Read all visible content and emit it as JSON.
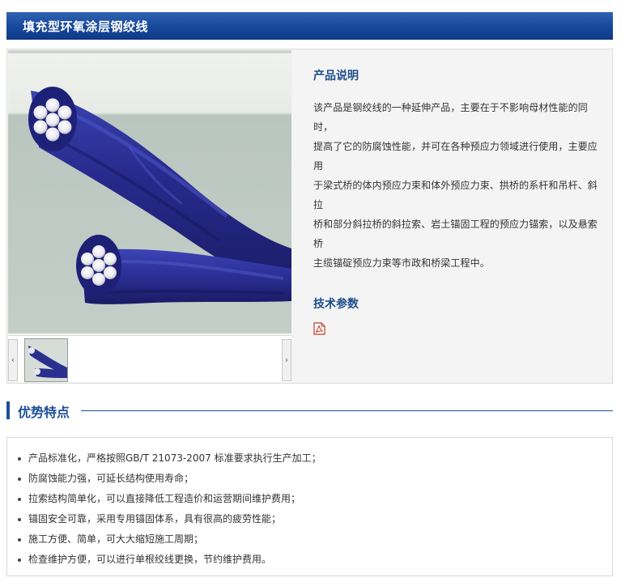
{
  "header": {
    "title": "填充型环氧涂层钢绞线"
  },
  "product": {
    "image_alt": "epoxy coated steel strand photo",
    "gallery": {
      "prev_arrow": "‹",
      "next_arrow": "›"
    },
    "description_title": "产品说明",
    "description_lines": [
      "该产品是钢绞线的一种延伸产品，主要在于不影响母材性能的同时，",
      "提高了它的防腐蚀性能，并可在各种预应力领域进行使用，主要应用",
      "于梁式桥的体内预应力束和体外预应力束、拱桥的系杆和吊杆、斜拉",
      "桥和部分斜拉桥的斜拉索、岩土锚固工程的预应力锚索，以及悬索桥",
      "主缆锚碇预应力束等市政和桥梁工程中。"
    ],
    "tech_title": "技术参数",
    "tech_icon": "pdf-icon"
  },
  "advantages": {
    "title": "优势特点",
    "items": [
      "产品标准化，严格按照GB/T 21073-2007 标准要求执行生产加工；",
      "防腐蚀能力强，可延长结构使用寿命；",
      "拉索结构简单化，可以直接降低工程造价和运营期间维护费用；",
      "锚固安全可靠，采用专用锚固体系，具有很高的疲劳性能；",
      "施工方便、简单，可大大缩短施工周期；",
      "检查维护方便，可以进行单根绞线更换，节约维护费用。"
    ]
  },
  "colors": {
    "header_bg": "#17489a",
    "accent": "#1c4e9a",
    "strand_blue": "#2a2f8f"
  }
}
